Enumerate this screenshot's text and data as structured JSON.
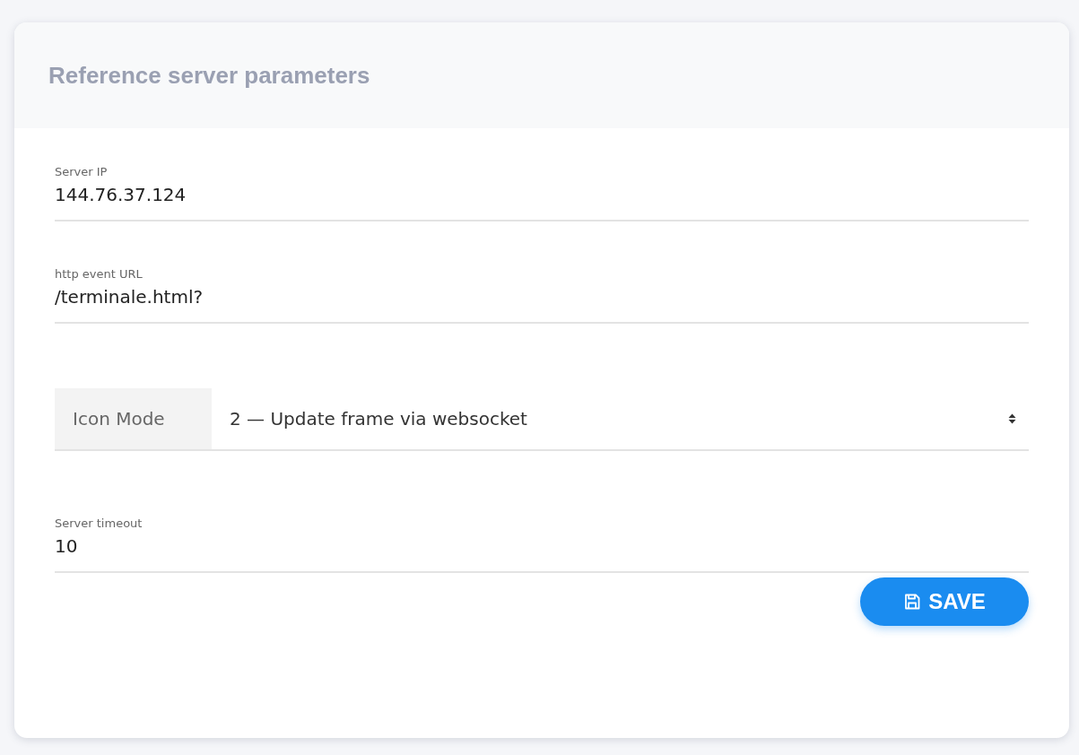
{
  "card": {
    "title": "Reference server parameters"
  },
  "fields": [
    {
      "kind": "text",
      "label": "Server IP",
      "value": "144.76.37.124"
    },
    {
      "kind": "text",
      "label": "http event URL",
      "value": "/terminale.html?"
    },
    {
      "kind": "select",
      "label": "Icon Mode",
      "value": "2 — Update frame via websocket"
    },
    {
      "kind": "text",
      "label": "Server timeout",
      "value": "10"
    }
  ],
  "save_button": {
    "label": "SAVE"
  }
}
